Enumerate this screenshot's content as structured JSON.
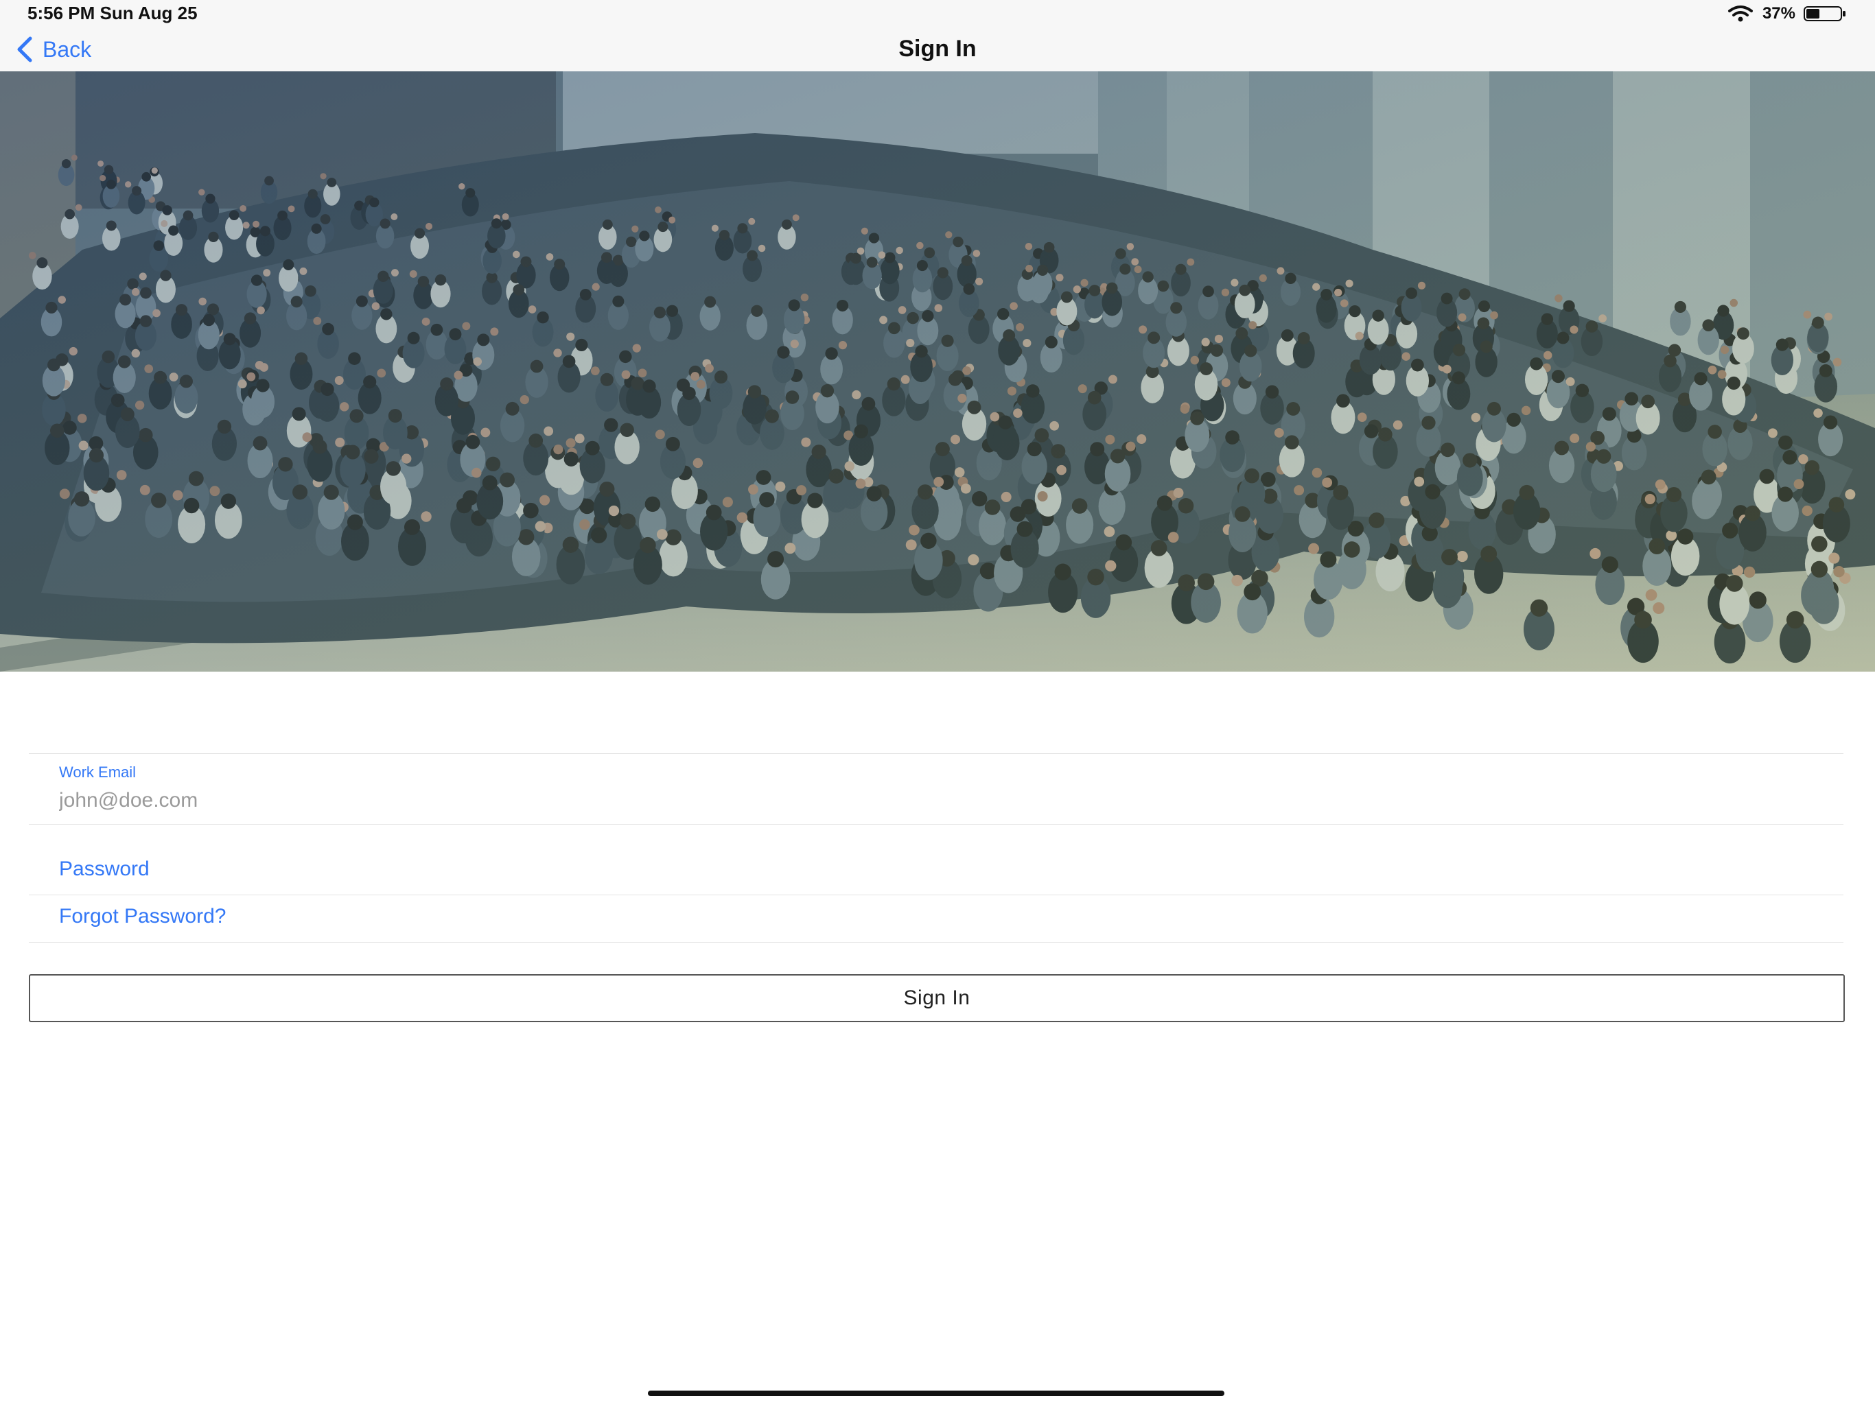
{
  "status_bar": {
    "time": "5:56 PM   Sun Aug 25",
    "battery": "37%",
    "icons": [
      "wifi-icon",
      "battery-icon"
    ]
  },
  "nav": {
    "back_label": "Back",
    "title": "Sign In",
    "back_icon": "chevron-left-icon"
  },
  "hero": {
    "image": "group-photo-crowd-waving"
  },
  "form": {
    "email_label": "Work Email",
    "email_placeholder": "john@doe.com",
    "email_value": "",
    "password_label": "Password",
    "forgot_password_label": "Forgot Password?",
    "sign_in_button_label": "Sign In"
  },
  "colors": {
    "accent": "#3478f6",
    "nav_background": "#f7f7f7",
    "button_border": "#555555"
  }
}
